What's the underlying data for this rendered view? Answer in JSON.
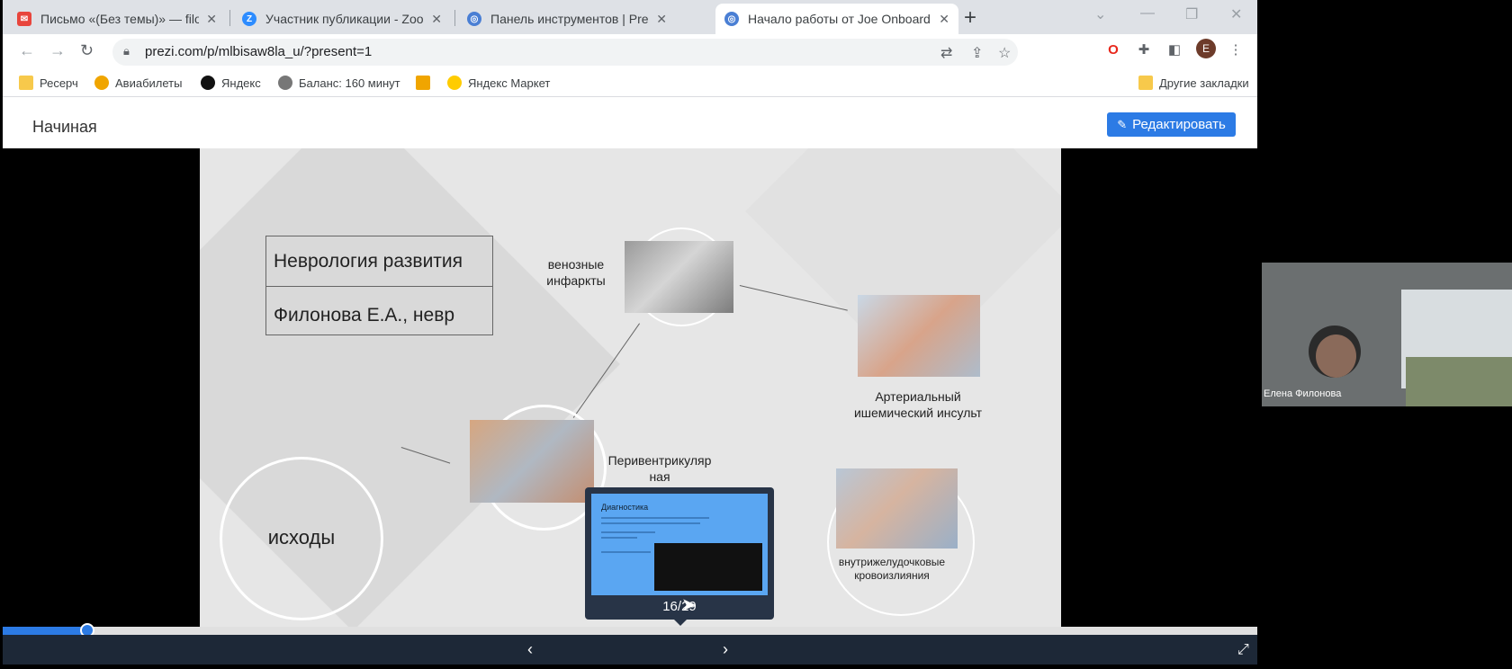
{
  "tabs": [
    {
      "title": "Письмо «(Без темы)» — filonov",
      "icon": "mail-icon",
      "color": "#e8453c"
    },
    {
      "title": "Участник публикации - Zoom",
      "icon": "zoom-icon",
      "color": "#2d8cff"
    },
    {
      "title": "Панель инструментов | Prezi",
      "icon": "globe-icon",
      "color": "#4a7fd4"
    },
    {
      "title": "Начало работы от Joe Onboard",
      "icon": "globe-icon",
      "color": "#4a7fd4"
    }
  ],
  "toolbar": {
    "url": "prezi.com/p/mlbisaw8la_u/?present=1",
    "avatar_letter": "E"
  },
  "bookmarks": [
    {
      "label": "Ресерч",
      "icon": "folder-icon"
    },
    {
      "label": "Авиабилеты",
      "icon": "plane-icon"
    },
    {
      "label": "Яндекс",
      "icon": "yandex-icon"
    },
    {
      "label": "Баланс: 160 минут",
      "icon": "globe-icon"
    },
    {
      "label": "",
      "icon": "mail-icon"
    },
    {
      "label": "Яндекс Маркет",
      "icon": "market-icon"
    }
  ],
  "other_bookmarks": "Другие закладки",
  "prezi": {
    "home": "Начиная",
    "edit_label": "Редактировать"
  },
  "slide": {
    "title": "Неврология развития",
    "author": "Филонова Е.А., невр",
    "venous": [
      "венозные",
      "инфаркты"
    ],
    "arterial": [
      "Артериальный",
      "ишемический инсульт"
    ],
    "periventricular": [
      "Перивентрикуляр",
      "ная"
    ],
    "intraventricular": [
      "внутрижелудочковые",
      "кровоизлияния"
    ],
    "outcomes": "исходы"
  },
  "thumbnail": {
    "title": "Диагностика",
    "counter": "16/29"
  },
  "progress": {
    "value": 16,
    "total": 29
  },
  "webcam": {
    "name": "Елена Филонова"
  },
  "colors": {
    "accent": "#2c7be5",
    "controls_bg": "#1d2837",
    "thumb_bg": "#283447",
    "thumb_screen": "#5aa6f2"
  }
}
